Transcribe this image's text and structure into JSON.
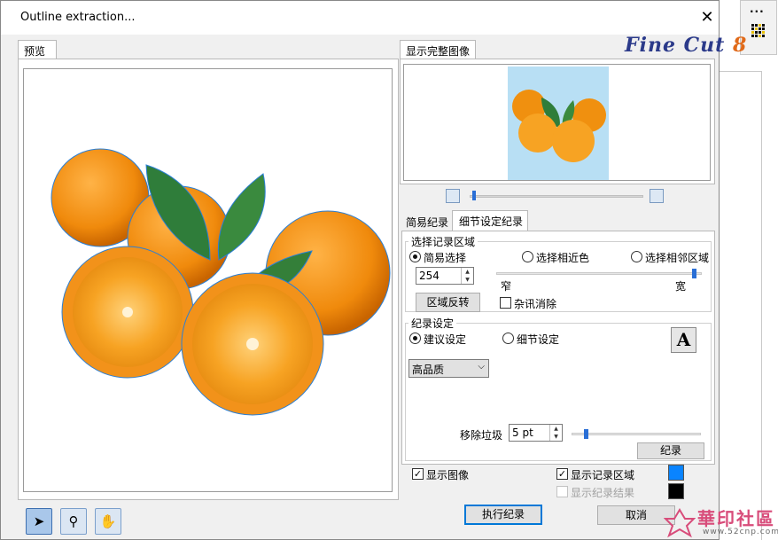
{
  "window": {
    "title": "Outline extraction...",
    "close_glyph": "✕"
  },
  "background_app": {
    "palette_dots": "..."
  },
  "logo": {
    "part1": "Fine Cut",
    "part2": "8"
  },
  "preview_tab": {
    "label": "预览"
  },
  "full_image": {
    "tab_label": "显示完整图像",
    "thumb_bg_color": "#b8dff4"
  },
  "record_tabs": {
    "simple": "简易纪录",
    "detail": "细节设定纪录",
    "active": "detail"
  },
  "select_area": {
    "legend": "选择记录区域",
    "radio_simple": "简易选择",
    "radio_similar": "选择相近色",
    "radio_adjacent": "选择相邻区域",
    "selected": "simple",
    "value": "254",
    "invert_button": "区域反转",
    "slider_narrow": "窄",
    "slider_wide": "宽",
    "slider_level": 1.0,
    "noise_remove_label": "杂讯消除",
    "noise_remove_checked": false
  },
  "record_settings": {
    "legend": "纪录设定",
    "radio_suggest": "建议设定",
    "radio_detail": "细节设定",
    "selected": "suggest",
    "quality_value": "高品质",
    "remove_garbage_label": "移除垃圾",
    "remove_garbage_value": "5 pt",
    "record_button": "纪录"
  },
  "display": {
    "show_image_label": "显示图像",
    "show_image_checked": true,
    "show_record_area_label": "显示记录区域",
    "show_record_area_checked": true,
    "show_record_result_label": "显示纪录结果",
    "show_record_result_checked": false,
    "area_color": "#0a84ff",
    "result_color": "#000000"
  },
  "actions": {
    "execute": "执行纪录",
    "cancel": "取消"
  },
  "watermark": {
    "text": "華印社區",
    "sub": "www.52cnp.com"
  }
}
